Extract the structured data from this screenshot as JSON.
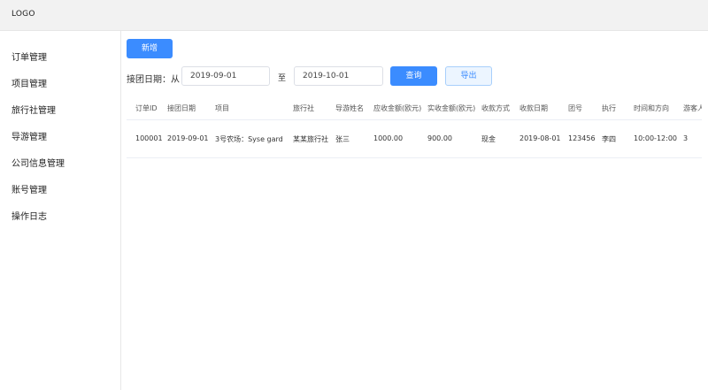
{
  "header": {
    "logo": "LOGO"
  },
  "sidebar": {
    "items": [
      {
        "label": "订单管理"
      },
      {
        "label": "项目管理"
      },
      {
        "label": "旅行社管理"
      },
      {
        "label": "导游管理"
      },
      {
        "label": "公司信息管理"
      },
      {
        "label": "账号管理"
      },
      {
        "label": "操作日志"
      }
    ]
  },
  "toolbar": {
    "add_label": "新增",
    "date_label": "接团日期：从",
    "date_from": "2019-09-01",
    "to_label": "至",
    "date_to": "2019-10-01",
    "query_label": "查询",
    "export_label": "导出"
  },
  "table": {
    "columns": [
      "订单ID",
      "接团日期",
      "项目",
      "旅行社",
      "导游姓名",
      "应收金额(欧元)",
      "实收金额(欧元)",
      "收款方式",
      "收款日期",
      "团号",
      "执行",
      "时间和方向",
      "游客人数"
    ],
    "rows": [
      [
        "100001",
        "2019-09-01",
        "3号农场：Syse gard",
        "某某旅行社",
        "张三",
        "1000.00",
        "900.00",
        "现金",
        "2019-08-01",
        "123456",
        "李四",
        "10:00-12:00",
        "3"
      ]
    ]
  },
  "colors": {
    "primary": "#3b8cff",
    "topbar_bg": "#f2f2f2",
    "border": "#e8e8e8"
  }
}
